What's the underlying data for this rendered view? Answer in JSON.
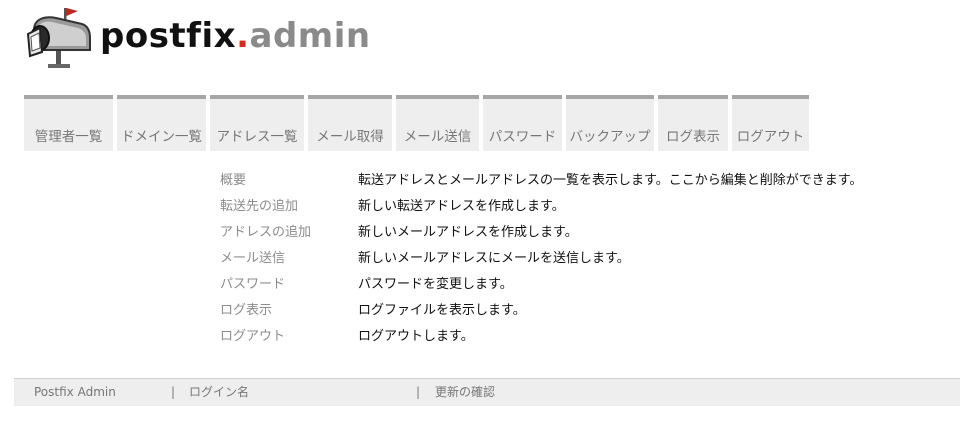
{
  "logo": {
    "text_part1": "postfix",
    "text_part2": ".",
    "text_part3": "admin",
    "icon": "mailbox-icon",
    "colors": {
      "dark": "#111111",
      "accent": "#d42a1f",
      "gray": "#8a8a8a"
    }
  },
  "menu": {
    "items": [
      {
        "label": "管理者一覧"
      },
      {
        "label": "ドメイン一覧"
      },
      {
        "label": "アドレス一覧"
      },
      {
        "label": "メール取得"
      },
      {
        "label": "メール送信"
      },
      {
        "label": "パスワード"
      },
      {
        "label": "バックアップ"
      },
      {
        "label": "ログ表示"
      },
      {
        "label": "ログアウト"
      }
    ]
  },
  "main": {
    "rows": [
      {
        "link": "概要",
        "description": "転送アドレスとメールアドレスの一覧を表示します。ここから編集と削除ができます。"
      },
      {
        "link": "転送先の追加",
        "description": "新しい転送アドレスを作成します。"
      },
      {
        "link": "アドレスの追加",
        "description": "新しいメールアドレスを作成します。"
      },
      {
        "link": "メール送信",
        "description": "新しいメールアドレスにメールを送信します。"
      },
      {
        "link": "パスワード",
        "description": "パスワードを変更します。"
      },
      {
        "link": "ログ表示",
        "description": "ログファイルを表示します。"
      },
      {
        "link": "ログアウト",
        "description": "ログアウトします。"
      }
    ]
  },
  "footer": {
    "app_name": "Postfix Admin",
    "separator": "|",
    "login_name": "ログイン名",
    "update_check": "更新の確認"
  }
}
